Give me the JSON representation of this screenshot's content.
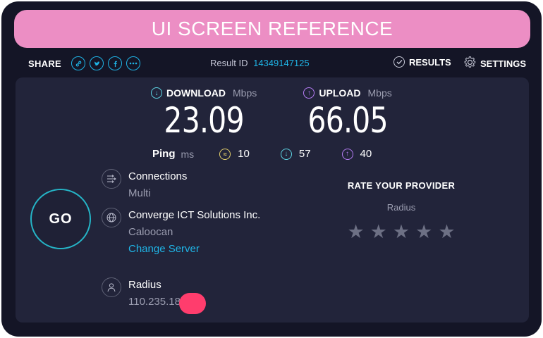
{
  "banner": {
    "text": "UI SCREEN REFERENCE"
  },
  "topbar": {
    "share_label": "SHARE",
    "share_icons": [
      "link-icon",
      "twitter-icon",
      "facebook-icon",
      "more-icon"
    ],
    "result_id_label": "Result ID",
    "result_id_value": "14349147125",
    "results_label": "RESULTS",
    "settings_label": "SETTINGS"
  },
  "download": {
    "label": "DOWNLOAD",
    "unit": "Mbps",
    "value": "23.09"
  },
  "upload": {
    "label": "UPLOAD",
    "unit": "Mbps",
    "value": "66.05"
  },
  "ping": {
    "label": "Ping",
    "unit": "ms",
    "idle": "10",
    "download": "57",
    "upload": "40"
  },
  "go_label": "GO",
  "connections": {
    "title": "Connections",
    "value": "Multi"
  },
  "server": {
    "name": "Converge ICT Solutions Inc.",
    "location": "Caloocan",
    "change_link": "Change Server"
  },
  "client": {
    "name": "Radius",
    "ip": "110.235.186"
  },
  "rate_provider": {
    "title": "RATE YOUR PROVIDER",
    "provider": "Radius",
    "stars": 5
  },
  "colors": {
    "accent": "#1fb4e6",
    "download": "#5fd7e6",
    "upload": "#b57cf4",
    "background": "#141526",
    "panel": "#22243a"
  }
}
